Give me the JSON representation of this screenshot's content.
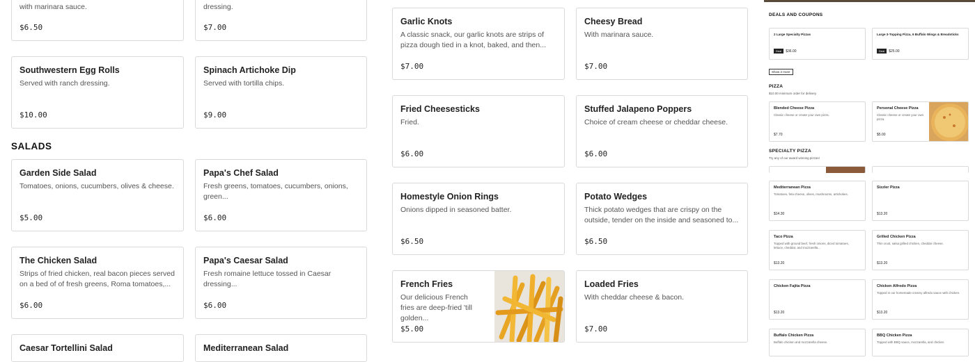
{
  "left": {
    "row0": [
      {
        "desc": "with marinara sauce.",
        "price": "$6.50"
      },
      {
        "desc": "dressing.",
        "price": "$7.00"
      }
    ],
    "row1": [
      {
        "name": "Southwestern Egg Rolls",
        "desc": "Served with ranch dressing.",
        "price": "$10.00"
      },
      {
        "name": "Spinach Artichoke Dip",
        "desc": "Served with tortilla chips.",
        "price": "$9.00"
      }
    ],
    "salads_header": "SALADS",
    "row2": [
      {
        "name": "Garden Side Salad",
        "desc": "Tomatoes, onions, cucumbers, olives & cheese.",
        "price": "$5.00"
      },
      {
        "name": "Papa's Chef Salad",
        "desc": "Fresh greens, tomatoes, cucumbers, onions, green...",
        "price": "$6.00"
      }
    ],
    "row3": [
      {
        "name": "The Chicken Salad",
        "desc": "Strips of fried chicken, real bacon pieces served on a bed of of fresh greens, Roma tomatoes,...",
        "price": "$6.00"
      },
      {
        "name": "Papa's Caesar Salad",
        "desc": "Fresh romaine lettuce tossed in Caesar dressing...",
        "price": "$6.00"
      }
    ],
    "row4": [
      {
        "name": "Caesar Tortellini Salad"
      },
      {
        "name": "Mediterranean Salad"
      }
    ]
  },
  "mid": [
    {
      "name": "Garlic Knots",
      "desc": "A classic snack, our garlic knots are strips of pizza dough tied in a knot, baked, and then...",
      "price": "$7.00"
    },
    {
      "name": "Cheesy Bread",
      "desc": "With marinara sauce.",
      "price": "$7.00"
    },
    {
      "name": "Fried Cheesesticks",
      "desc": "Fried.",
      "price": "$6.00"
    },
    {
      "name": "Stuffed Jalapeno Poppers",
      "desc": "Choice of cream cheese or cheddar cheese.",
      "price": "$6.00"
    },
    {
      "name": "Homestyle Onion Rings",
      "desc": "Onions dipped in seasoned batter.",
      "price": "$6.50"
    },
    {
      "name": "Potato Wedges",
      "desc": "Thick potato wedges that are crispy on the outside, tender on the inside and seasoned to...",
      "price": "$6.50"
    },
    {
      "name": "French Fries",
      "desc": "Our delicious French fries are deep-fried 'till golden...",
      "price": "$5.00"
    },
    {
      "name": "Loaded Fries",
      "desc": "With cheddar cheese & bacon.",
      "price": "$7.00"
    }
  ],
  "right": {
    "deals_header": "DEALS AND COUPONS",
    "deals": [
      {
        "name": "2 Large Specialty Pizzas",
        "badge": "Deal",
        "price": "$36.00"
      },
      {
        "name": "Large 3-Topping Pizza, 6 Buffalo Wings & Breadsticks",
        "badge": "Deal",
        "price": "$25.00"
      }
    ],
    "show_more": "Show 2 more",
    "pizza_header": "PIZZA",
    "pizza_sub": "$10.00 minimum order for delivery",
    "pizzas": [
      {
        "name": "Blended Cheese Pizza",
        "desc": "Classic cheese or create your own pizza.",
        "price": "$7.70"
      },
      {
        "name": "Personal Cheese Pizza",
        "desc": "Classic cheese or create your own pizza.",
        "price": "$5.00"
      }
    ],
    "specialty_header": "SPECIALTY PIZZA",
    "specialty_sub": "Try any of our award winning pizzas!",
    "specialty": [
      {
        "name": "Mediterranean Pizza",
        "desc": "Tomatoes, feta cheese, olives, mushrooms, artichokes.",
        "price": "$14.30"
      },
      {
        "name": "Sizzler Pizza",
        "desc": "",
        "price": "$13.20"
      },
      {
        "name": "Taco Pizza",
        "desc": "Topped with ground beef, fresh onions, diced tomatoes, lettuce, cheddar, and mozzarella...",
        "price": "$13.20"
      },
      {
        "name": "Grilled Chicken Pizza",
        "desc": "Thin crust, salsa grilled chicken, cheddar cheese.",
        "price": "$13.20"
      },
      {
        "name": "Chicken Fajita Pizza",
        "desc": "",
        "price": "$13.20"
      },
      {
        "name": "Chicken Alfredo Pizza",
        "desc": "Topped in our homemade creamy alfredo sauce with chicken.",
        "price": "$13.20"
      },
      {
        "name": "Buffalo Chicken Pizza",
        "desc": "Buffalo chicken and mozzarella cheese.",
        "price": ""
      },
      {
        "name": "BBQ Chicken Pizza",
        "desc": "Topped with BBQ sauce, mozzarella, and chicken",
        "price": ""
      }
    ]
  }
}
